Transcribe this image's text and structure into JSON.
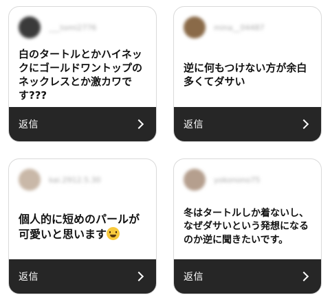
{
  "cards": [
    {
      "username": "___tomi2776",
      "avatar_color": "#3a3a3a",
      "message": "白のタートルとかハイネックにゴールドワントップのネックレスとか激カワです???",
      "reply_label": "返信"
    },
    {
      "username": "mina__04487",
      "avatar_color": "#8a6a48",
      "message": "逆に何もつけない方が余白多くてダサい",
      "reply_label": "返信"
    },
    {
      "username": "kai.2912.5.30",
      "avatar_color": "#c9b8a8",
      "message": "個人的に短めのパールが可愛いと思います",
      "emoji": "laughing-face",
      "reply_label": "返信"
    },
    {
      "username": "yokonono75",
      "avatar_color": "#b59f8e",
      "message": "冬はタートルしか着ないし、なぜダサいという発想になるのか逆に聞きたいです。",
      "reply_label": "返信"
    }
  ],
  "colors": {
    "reply_bar": "#262626",
    "card_border": "#d9d9d9",
    "message_text": "#111111"
  }
}
